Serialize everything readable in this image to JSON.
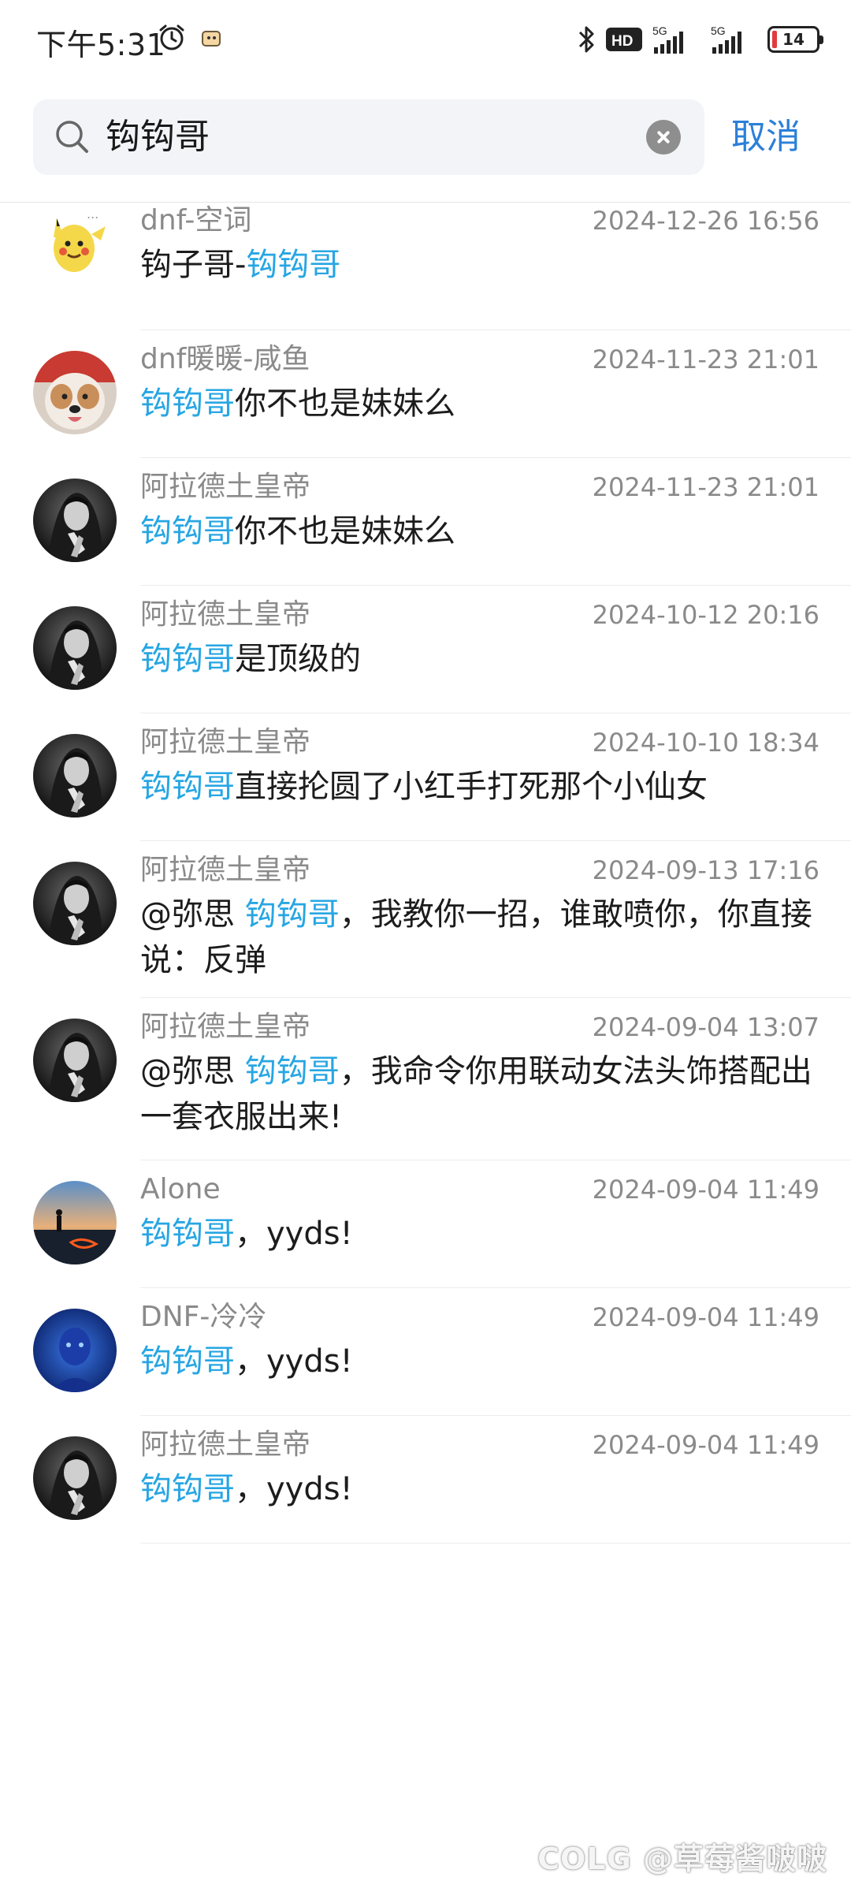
{
  "status_bar": {
    "time": "下午5:31",
    "network_badge": "HD",
    "signal_1_label": "5G",
    "signal_2_label": "5G",
    "battery_level": "14",
    "icons": [
      "alarm-icon",
      "app-notification-icon",
      "bluetooth-icon",
      "hd-voice-icon",
      "signal-icon",
      "battery-icon"
    ]
  },
  "search": {
    "query": "钩钩哥",
    "cancel_label": "取消",
    "icons": [
      "search-icon",
      "clear-icon"
    ]
  },
  "colors": {
    "highlight": "#27a6e3",
    "cancel": "#2b7fd9",
    "meta_text": "#8a8a8a",
    "battery_low": "#e23b3b"
  },
  "results": [
    {
      "name": "dnf-空词",
      "time": "2024-12-26 16:56",
      "avatar": "pikachu-avatar",
      "message": [
        {
          "t": "钩子哥-"
        },
        {
          "t": "钩钩哥",
          "hl": true
        }
      ]
    },
    {
      "name": "dnf暖暖-咸鱼",
      "time": "2024-11-23 21:01",
      "avatar": "dog-avatar",
      "message": [
        {
          "t": "钩钩哥",
          "hl": true
        },
        {
          "t": "你不也是妹妹么"
        }
      ]
    },
    {
      "name": "阿拉德土皇帝",
      "time": "2024-11-23 21:01",
      "avatar": "dark-portrait-avatar",
      "message": [
        {
          "t": "钩钩哥",
          "hl": true
        },
        {
          "t": "你不也是妹妹么"
        }
      ]
    },
    {
      "name": "阿拉德土皇帝",
      "time": "2024-10-12 20:16",
      "avatar": "dark-portrait-avatar",
      "message": [
        {
          "t": "钩钩哥",
          "hl": true
        },
        {
          "t": "是顶级的"
        }
      ]
    },
    {
      "name": "阿拉德土皇帝",
      "time": "2024-10-10 18:34",
      "avatar": "dark-portrait-avatar",
      "message": [
        {
          "t": "钩钩哥",
          "hl": true
        },
        {
          "t": "直接抡圆了小红手打死那个小仙女"
        }
      ]
    },
    {
      "name": "阿拉德土皇帝",
      "time": "2024-09-13 17:16",
      "avatar": "dark-portrait-avatar",
      "message": [
        {
          "t": "@弥思 "
        },
        {
          "t": "钩钩哥",
          "hl": true
        },
        {
          "t": "，我教你一招，谁敢喷你，你直接说：反弹"
        }
      ]
    },
    {
      "name": "阿拉德土皇帝",
      "time": "2024-09-04 13:07",
      "avatar": "dark-portrait-avatar",
      "message": [
        {
          "t": "@弥思 "
        },
        {
          "t": "钩钩哥",
          "hl": true
        },
        {
          "t": "，我命令你用联动女法头饰搭配出一套衣服出来!"
        }
      ]
    },
    {
      "name": "Alone",
      "time": "2024-09-04 11:49",
      "avatar": "sunset-avatar",
      "message": [
        {
          "t": "钩钩哥",
          "hl": true
        },
        {
          "t": "，yyds!"
        }
      ]
    },
    {
      "name": "DNF-冷冷",
      "time": "2024-09-04 11:49",
      "avatar": "blue-figure-avatar",
      "message": [
        {
          "t": "钩钩哥",
          "hl": true
        },
        {
          "t": "，yyds!"
        }
      ]
    },
    {
      "name": "阿拉德土皇帝",
      "time": "2024-09-04 11:49",
      "avatar": "dark-portrait-avatar",
      "message": [
        {
          "t": "钩钩哥",
          "hl": true
        },
        {
          "t": "，yyds!"
        }
      ]
    }
  ],
  "watermark": "COLG @草莓酱啵啵"
}
